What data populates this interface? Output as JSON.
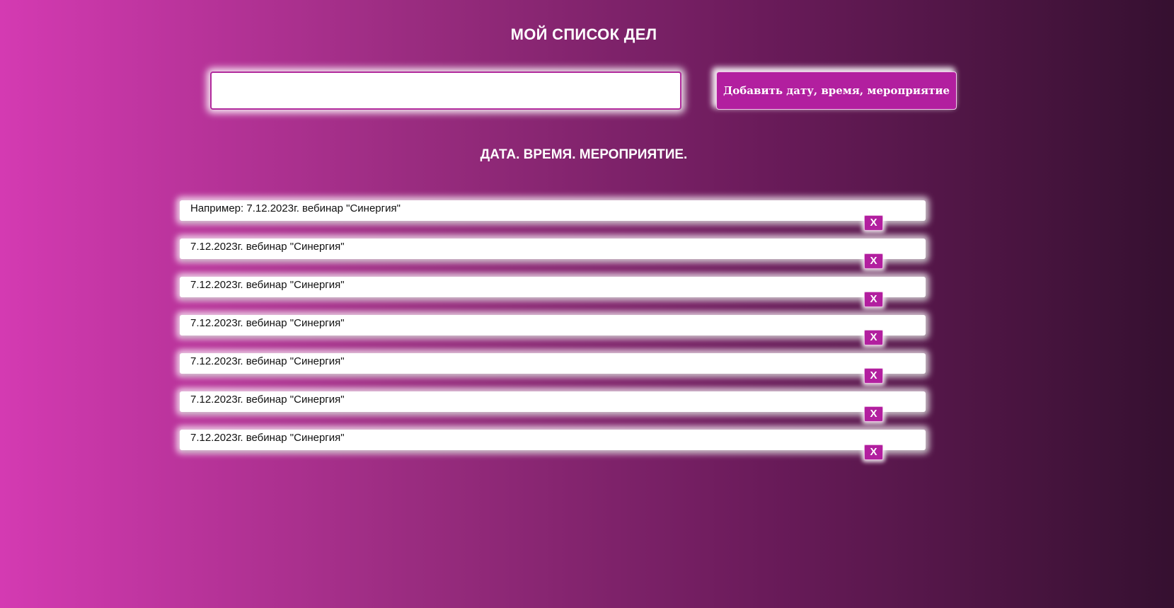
{
  "header": {
    "title": "МОЙ СПИСОК ДЕЛ"
  },
  "form": {
    "input_value": "",
    "add_button_label": "Добавить дату, время, мероприятие"
  },
  "list": {
    "heading": "ДАТА. ВРЕМЯ. МЕРОПРИЯТИЕ.",
    "delete_label": "X",
    "items": [
      {
        "text": "Например: 7.12.2023г. вебинар \"Синергия\""
      },
      {
        "text": "7.12.2023г. вебинар \"Синергия\""
      },
      {
        "text": "7.12.2023г. вебинар \"Синергия\""
      },
      {
        "text": "7.12.2023г. вебинар \"Синергия\""
      },
      {
        "text": "7.12.2023г. вебинар \"Синергия\""
      },
      {
        "text": "7.12.2023г. вебинар \"Синергия\""
      },
      {
        "text": "7.12.2023г. вебинар \"Синергия\""
      }
    ]
  },
  "colors": {
    "accent": "#b21f9f",
    "gradient_start": "#d43ab2",
    "gradient_end": "#351030"
  }
}
